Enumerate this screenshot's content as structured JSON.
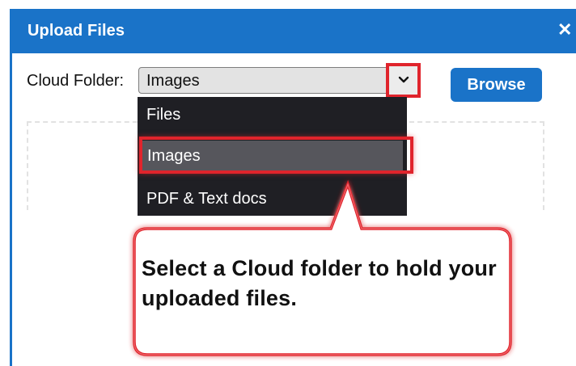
{
  "dialog": {
    "title": "Upload Files",
    "close_icon": "close-icon"
  },
  "folder": {
    "label": "Cloud Folder:",
    "selected": "Images",
    "options": [
      "Files",
      "Images",
      "PDF & Text docs"
    ],
    "highlighted_option": "Images"
  },
  "browse_label": "Browse",
  "callout": {
    "text": "Select a Cloud folder to hold your uploaded files."
  },
  "colors": {
    "accent": "#1a73c8",
    "highlight": "#e0242c",
    "dropdown_bg": "#1f1f24",
    "selected_option_bg": "#56565c"
  }
}
